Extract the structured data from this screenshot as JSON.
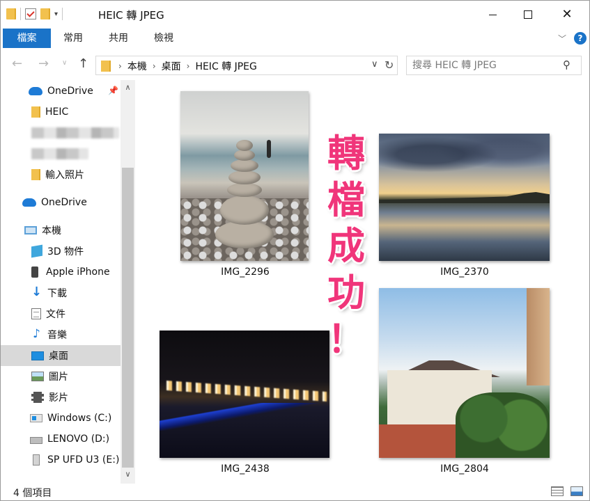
{
  "window": {
    "title": "HEIC 轉 JPEG",
    "quick_access_dropdown": "▾"
  },
  "ribbon": {
    "tabs": [
      {
        "label": "檔案",
        "active": true
      },
      {
        "label": "常用"
      },
      {
        "label": "共用"
      },
      {
        "label": "檢視"
      }
    ],
    "help": "?"
  },
  "address": {
    "breadcrumbs": [
      "本機",
      "桌面",
      "HEIC 轉 JPEG"
    ],
    "separator": "›"
  },
  "search": {
    "placeholder": "搜尋 HEIC 轉 JPEG"
  },
  "sidebar": {
    "items": [
      {
        "label": "OneDrive",
        "icon": "onedrive-cloud-icon",
        "pinned": true
      },
      {
        "label": "HEIC",
        "icon": "folder-icon"
      },
      {
        "label": "",
        "icon": "none",
        "blurred": true
      },
      {
        "label": "",
        "icon": "none",
        "blurred": true
      },
      {
        "label": "輸入照片",
        "icon": "folder-icon"
      },
      {
        "label": "OneDrive",
        "icon": "onedrive-cloud-icon"
      },
      {
        "label": "本機",
        "icon": "this-pc-icon"
      },
      {
        "label": "3D 物件",
        "icon": "3d-objects-icon"
      },
      {
        "label": "Apple iPhone",
        "icon": "iphone-icon"
      },
      {
        "label": "下載",
        "icon": "downloads-icon"
      },
      {
        "label": "文件",
        "icon": "documents-icon"
      },
      {
        "label": "音樂",
        "icon": "music-icon"
      },
      {
        "label": "桌面",
        "icon": "desktop-icon",
        "selected": true
      },
      {
        "label": "圖片",
        "icon": "pictures-icon"
      },
      {
        "label": "影片",
        "icon": "videos-icon"
      },
      {
        "label": "Windows (C:)",
        "icon": "windows-drive-icon"
      },
      {
        "label": "LENOVO (D:)",
        "icon": "drive-icon"
      },
      {
        "label": "SP UFD U3 (E:)",
        "icon": "usb-drive-icon"
      }
    ]
  },
  "files": [
    {
      "name": "IMG_2296",
      "thumbnail": "cairn-beach-photo"
    },
    {
      "name": "IMG_2370",
      "thumbnail": "sunset-river-photo"
    },
    {
      "name": "IMG_2438",
      "thumbnail": "night-pier-photo"
    },
    {
      "name": "IMG_2804",
      "thumbnail": "house-trees-photo"
    }
  ],
  "overlay": {
    "chars": [
      "轉",
      "檔",
      "成",
      "功",
      "！"
    ],
    "color": "#f0357a"
  },
  "status": {
    "item_count": "4 個項目"
  },
  "colors": {
    "accent": "#1a73c8",
    "selected_bg": "#d9d9d9"
  }
}
